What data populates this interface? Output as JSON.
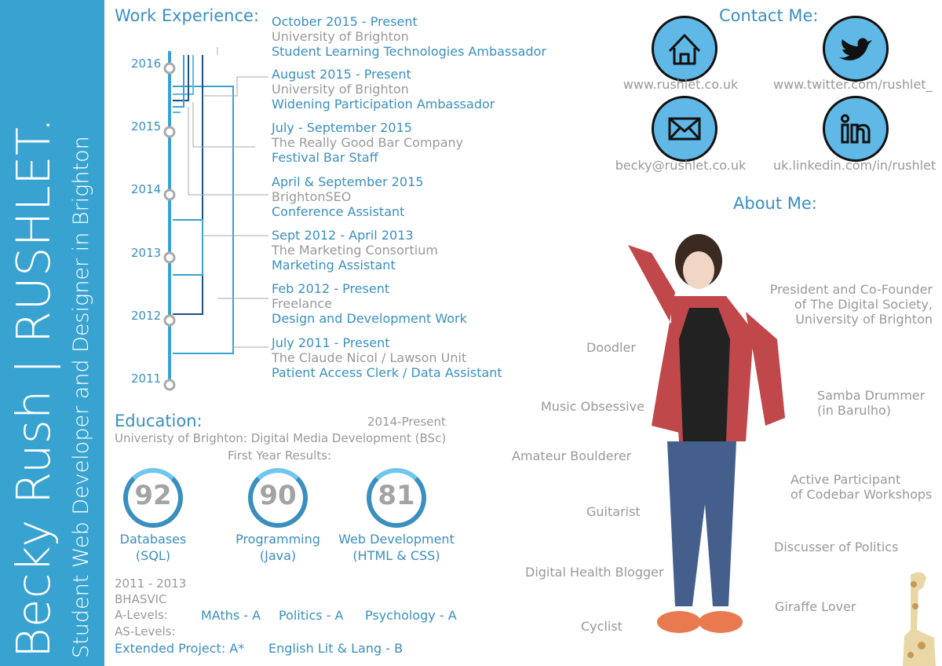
{
  "sidebar": {
    "name": "Becky Rush | RUSHLET.",
    "tagline": "Student Web Developer and Designer in Brighton"
  },
  "work": {
    "heading": "Work Experience:",
    "years": [
      "2016",
      "2015",
      "2014",
      "2013",
      "2012",
      "2011"
    ],
    "jobs": [
      {
        "date": "October 2015 - Present",
        "org": "University of Brighton",
        "role": "Student Learning Technologies Ambassador"
      },
      {
        "date": "August 2015 - Present",
        "org": "University of Brighton",
        "role": "Widening Participation Ambassador"
      },
      {
        "date": "July - September 2015",
        "org": "The Really Good Bar Company",
        "role": "Festival Bar Staff"
      },
      {
        "date": "April & September 2015",
        "org": "BrightonSEO",
        "role": "Conference Assistant"
      },
      {
        "date": "Sept 2012 - April 2013",
        "org": "The Marketing Consortium",
        "role": "Marketing Assistant"
      },
      {
        "date": "Feb 2012 - Present",
        "org": "Freelance",
        "role": "Design and Development Work"
      },
      {
        "date": "July 2011 - Present",
        "org": "The Claude Nicol / Lawson Unit",
        "role": "Patient Access Clerk / Data Assistant"
      }
    ]
  },
  "education": {
    "heading": "Education:",
    "uni_period": "2014-Present",
    "uni_course": "Univeristy of Brighton: Digital Media Development (BSc)",
    "results_label": "First Year Results:",
    "results": [
      {
        "score": "92",
        "line1": "Databases",
        "line2": "(SQL)"
      },
      {
        "score": "90",
        "line1": "Programming",
        "line2": "(Java)"
      },
      {
        "score": "81",
        "line1": "Web Development",
        "line2": "(HTML & CSS)"
      }
    ],
    "college_period": "2011 - 2013",
    "college_name": "BHASVIC",
    "alevels_label": "A-Levels:",
    "alevels": [
      "MAths - A",
      "Politics - A",
      "Psychology - A"
    ],
    "aslevels_label": "AS-Levels:",
    "aslevels": [
      "Extended Project: A*",
      "English Lit & Lang - B"
    ]
  },
  "contact": {
    "heading": "Contact Me:",
    "items": [
      {
        "icon": "home-icon",
        "text": "www.rushlet.co.uk"
      },
      {
        "icon": "twitter-icon",
        "text": "www.twitter.com/rushlet_"
      },
      {
        "icon": "mail-icon",
        "text": "becky@rushlet.co.uk"
      },
      {
        "icon": "linkedin-icon",
        "text": "uk.linkedin.com/in/rushlet"
      }
    ]
  },
  "about": {
    "heading": "About Me:",
    "left": [
      "Doodler",
      "Music Obsessive",
      "Amateur Boulderer",
      "Guitarist",
      "Digital Health Blogger",
      "Cyclist"
    ],
    "right": [
      {
        "l1": "President and Co-Founder",
        "l2": "of The Digital Society,",
        "l3": "University of Brighton"
      },
      {
        "l1": "Samba Drummer",
        "l2": "(in Barulho)"
      },
      {
        "l1": "Active Participant",
        "l2": "of Codebar Workshops"
      },
      {
        "l1": "Discusser of Politics"
      },
      {
        "l1": "Giraffe Lover"
      }
    ]
  },
  "colors": {
    "sidebar": "#38a3d1",
    "accent": "#3a8fbf",
    "text_grey": "#999999"
  }
}
